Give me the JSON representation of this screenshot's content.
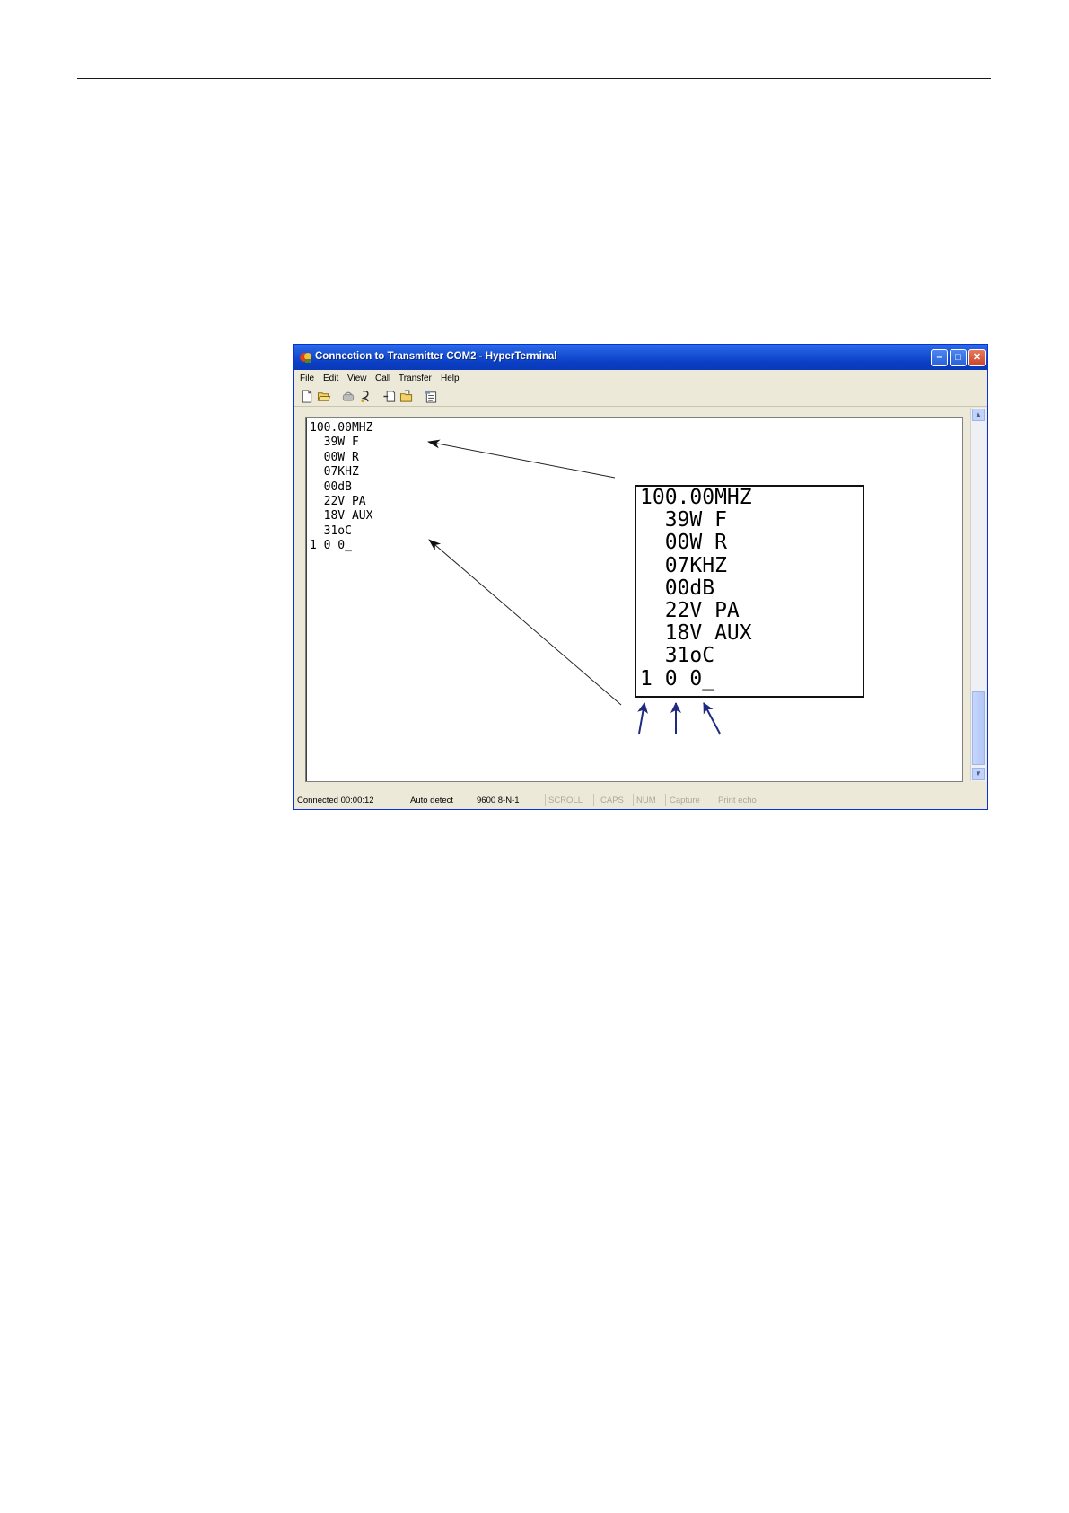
{
  "window": {
    "title": "Connection to Transmitter COM2 - HyperTerminal",
    "buttons": {
      "minimize": "–",
      "maximize": "□",
      "close": "✕"
    },
    "menu": [
      "File",
      "Edit",
      "View",
      "Call",
      "Transfer",
      "Help"
    ],
    "toolbar_icons": [
      "new-icon",
      "open-icon",
      "disconnect-icon",
      "dial-icon",
      "send-icon",
      "receive-icon",
      "properties-icon"
    ]
  },
  "terminal": {
    "lines": [
      "100.00MHZ",
      "  39W F",
      "  00W R",
      "  07KHZ",
      "  00dB",
      "  22V PA",
      "  18V AUX",
      "  31oC",
      "1 0 0_"
    ]
  },
  "status": {
    "connected": "Connected 00:00:12",
    "detect": "Auto detect",
    "settings": "9600 8-N-1",
    "scroll": "SCROLL",
    "caps": "CAPS",
    "num": "NUM",
    "capture": "Capture",
    "print_echo": "Print echo"
  },
  "callout": {
    "lines": [
      "100.00MHZ",
      "  39W F",
      "  00W R",
      "  07KHZ",
      "  00dB",
      "  22V PA",
      "  18V AUX",
      "  31oC",
      "1 0 0_"
    ]
  },
  "colors": {
    "title_blue": "#0a3fc4",
    "arrow_blue": "#1f2a80"
  }
}
